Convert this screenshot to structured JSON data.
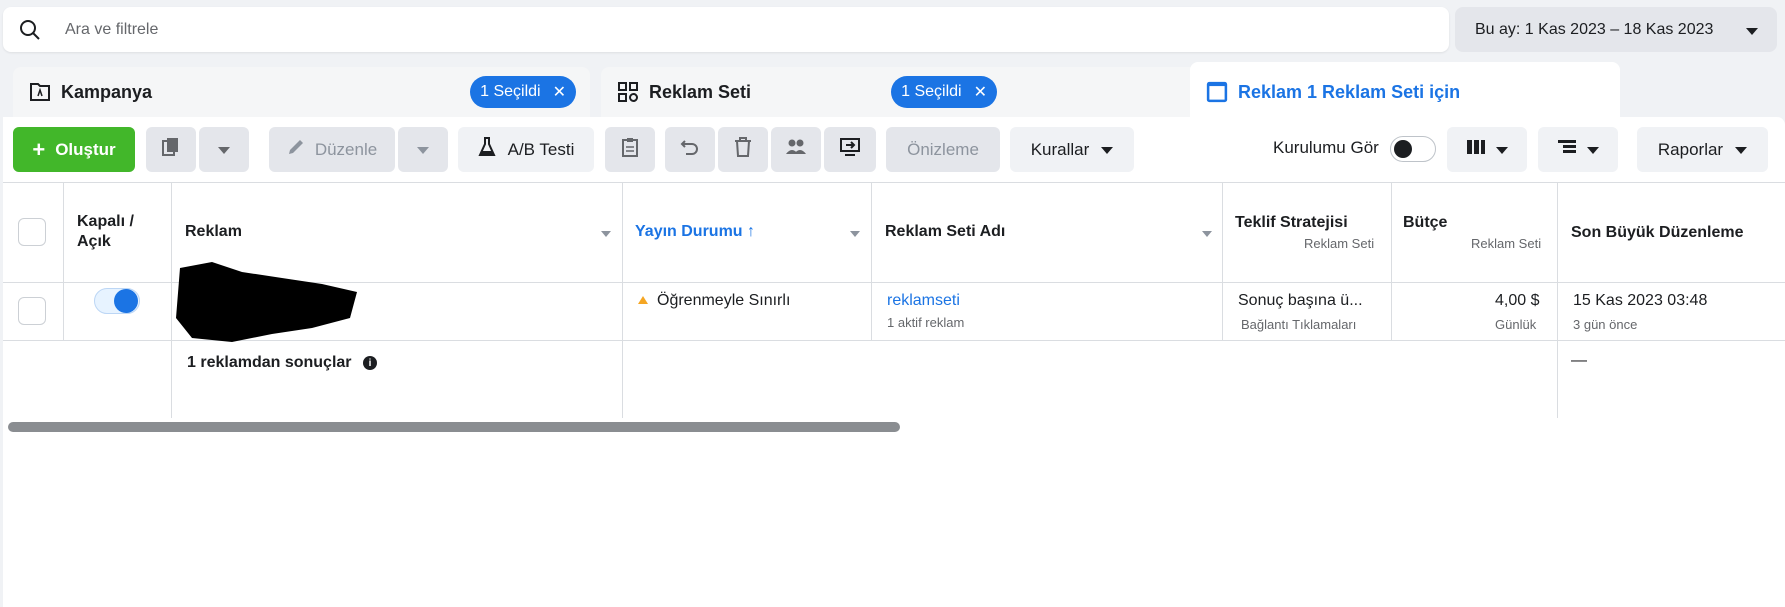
{
  "search": {
    "placeholder": "Ara ve filtrele",
    "value": ""
  },
  "date_range": {
    "label": "Bu ay: 1 Kas 2023 – 18 Kas 2023"
  },
  "tabs": [
    {
      "label": "Kampanya",
      "badge": "1 Seçildi",
      "icon": "folder-icon"
    },
    {
      "label": "Reklam Seti",
      "badge": "1 Seçildi",
      "icon": "grid-icon"
    },
    {
      "label": "Reklam 1 Reklam Seti için",
      "icon": "ad-window-icon",
      "active": true
    }
  ],
  "toolbar": {
    "create_label": "Oluştur",
    "edit_label": "Düzenle",
    "ab_test_label": "A/B Testi",
    "preview_label": "Önizleme",
    "rules_label": "Kurallar",
    "view_setup_label": "Kurulumu Gör",
    "reports_label": "Raporlar"
  },
  "table": {
    "headers": {
      "toggle": "Kapalı / Açık",
      "ad": "Reklam",
      "delivery": "Yayın Durumu",
      "adset_name": "Reklam Seti Adı",
      "bid_strategy": "Teklif Stratejisi",
      "bid_strategy_sub": "Reklam Seti",
      "budget": "Bütçe",
      "budget_sub": "Reklam Seti",
      "last_edit": "Son Büyük Düzenleme"
    },
    "rows": [
      {
        "delivery": "Öğrenmeyle Sınırlı",
        "adset_name": "reklamseti",
        "adset_sub": "1 aktif reklam",
        "bid_strategy": "Sonuç başına ü...",
        "bid_strategy_sub": "Bağlantı Tıklamaları",
        "budget": "4,00 $",
        "budget_sub": "Günlük",
        "last_edit": "15 Kas 2023 03:48",
        "last_edit_sub": "3 gün önce",
        "toggle_on": true
      }
    ],
    "summary": {
      "label": "1 reklamdan sonuçlar",
      "last_edit": "—"
    }
  },
  "colors": {
    "accent": "#1b74e4",
    "create": "#42b72a",
    "warning": "#f5a623"
  }
}
